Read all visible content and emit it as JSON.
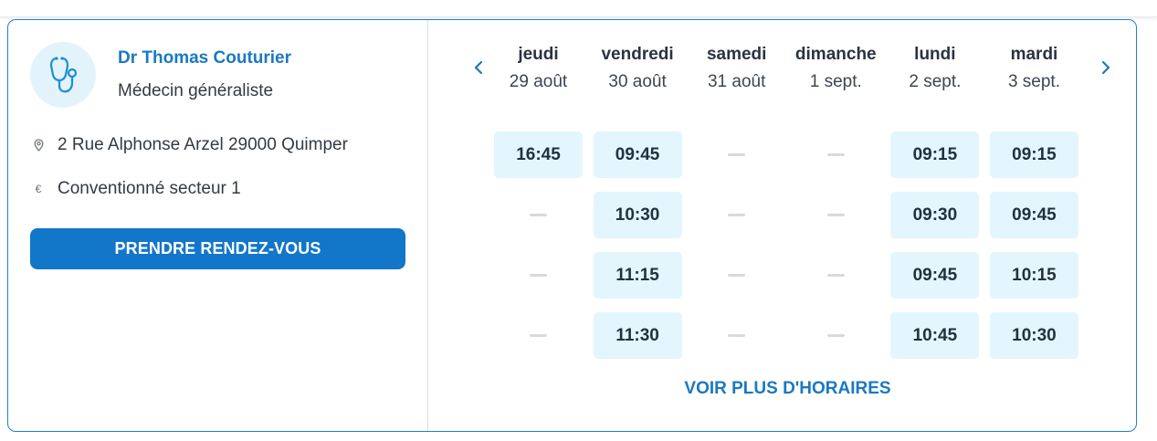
{
  "doctor": {
    "name": "Dr Thomas Couturier",
    "specialty": "Médecin généraliste",
    "address": "2 Rue Alphonse Arzel 29000 Quimper",
    "sector": "Conventionné secteur 1",
    "avatar_icon": "stethoscope-icon",
    "sector_icon_glyph": "€"
  },
  "actions": {
    "book_label": "PRENDRE RENDEZ-VOUS",
    "more_label": "VOIR PLUS D'HORAIRES"
  },
  "days": [
    {
      "name": "jeudi",
      "date": "29 août",
      "slots": [
        "16:45",
        "",
        "",
        ""
      ]
    },
    {
      "name": "vendredi",
      "date": "30 août",
      "slots": [
        "09:45",
        "10:30",
        "11:15",
        "11:30"
      ]
    },
    {
      "name": "samedi",
      "date": "31 août",
      "slots": [
        "",
        "",
        "",
        ""
      ]
    },
    {
      "name": "dimanche",
      "date": "1 sept.",
      "slots": [
        "",
        "",
        "",
        ""
      ]
    },
    {
      "name": "lundi",
      "date": "2 sept.",
      "slots": [
        "09:15",
        "09:30",
        "09:45",
        "10:45"
      ]
    },
    {
      "name": "mardi",
      "date": "3 sept.",
      "slots": [
        "09:15",
        "09:45",
        "10:15",
        "10:30"
      ]
    }
  ],
  "colors": {
    "accent": "#1276c9",
    "slot_bg": "#e3f6fd",
    "border": "#1f7fcf"
  }
}
